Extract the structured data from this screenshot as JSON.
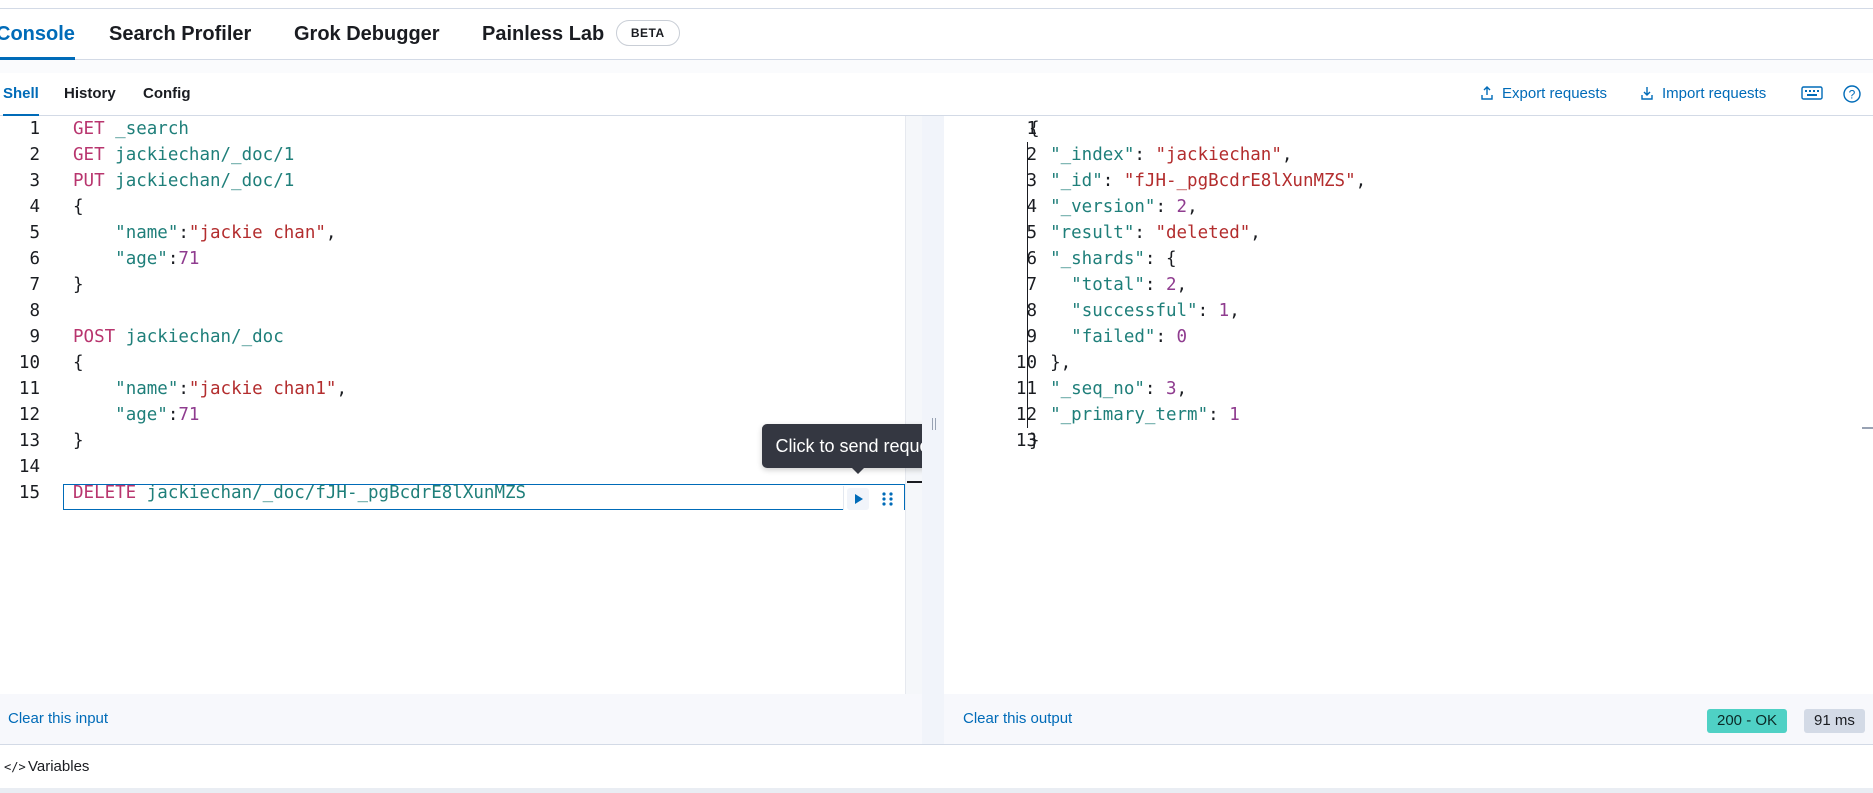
{
  "main_tabs": [
    {
      "label": "Console",
      "active": true
    },
    {
      "label": "Search Profiler",
      "active": false
    },
    {
      "label": "Grok Debugger",
      "active": false
    },
    {
      "label": "Painless Lab",
      "active": false,
      "badge": "BETA"
    }
  ],
  "sub_tabs": [
    {
      "label": "Shell",
      "active": true
    },
    {
      "label": "History",
      "active": false
    },
    {
      "label": "Config",
      "active": false
    }
  ],
  "actions": {
    "export": "Export requests",
    "import": "Import requests",
    "keyboard_icon": "keyboard-icon",
    "help_icon": "help-icon"
  },
  "request": {
    "line_numbers": [
      "1",
      "2",
      "3",
      "4",
      "5",
      "6",
      "7",
      "8",
      "9",
      "10",
      "11",
      "12",
      "13",
      "14",
      "15"
    ],
    "lines": [
      [
        {
          "t": "kw",
          "v": "GET"
        },
        {
          "t": "pun",
          "v": " "
        },
        {
          "t": "url",
          "v": "_search"
        }
      ],
      [
        {
          "t": "kw",
          "v": "GET"
        },
        {
          "t": "pun",
          "v": " "
        },
        {
          "t": "url",
          "v": "jackiechan/_doc/1"
        }
      ],
      [
        {
          "t": "kw",
          "v": "PUT"
        },
        {
          "t": "pun",
          "v": " "
        },
        {
          "t": "url",
          "v": "jackiechan/_doc/1"
        }
      ],
      [
        {
          "t": "pun",
          "v": "{"
        }
      ],
      [
        {
          "t": "pun",
          "v": "    "
        },
        {
          "t": "key",
          "v": "\"name\""
        },
        {
          "t": "pun",
          "v": ":"
        },
        {
          "t": "str",
          "v": "\"jackie chan\""
        },
        {
          "t": "pun",
          "v": ","
        }
      ],
      [
        {
          "t": "pun",
          "v": "    "
        },
        {
          "t": "key",
          "v": "\"age\""
        },
        {
          "t": "pun",
          "v": ":"
        },
        {
          "t": "num",
          "v": "71"
        }
      ],
      [
        {
          "t": "pun",
          "v": "}"
        }
      ],
      [],
      [
        {
          "t": "kw",
          "v": "POST"
        },
        {
          "t": "pun",
          "v": " "
        },
        {
          "t": "url",
          "v": "jackiechan/_doc"
        }
      ],
      [
        {
          "t": "pun",
          "v": "{"
        }
      ],
      [
        {
          "t": "pun",
          "v": "    "
        },
        {
          "t": "key",
          "v": "\"name\""
        },
        {
          "t": "pun",
          "v": ":"
        },
        {
          "t": "str",
          "v": "\"jackie chan1\""
        },
        {
          "t": "pun",
          "v": ","
        }
      ],
      [
        {
          "t": "pun",
          "v": "    "
        },
        {
          "t": "key",
          "v": "\"age\""
        },
        {
          "t": "pun",
          "v": ":"
        },
        {
          "t": "num",
          "v": "71"
        }
      ],
      [
        {
          "t": "pun",
          "v": "}"
        }
      ],
      [],
      [
        {
          "t": "kw",
          "v": "DELETE"
        },
        {
          "t": "pun",
          "v": " "
        },
        {
          "t": "url",
          "v": "jackiechan/_doc/fJH-_pgBcdrE8lXunMZS"
        }
      ]
    ]
  },
  "response": {
    "line_numbers": [
      "1",
      "2",
      "3",
      "4",
      "5",
      "6",
      "7",
      "8",
      "9",
      "10",
      "11",
      "12",
      "13"
    ],
    "lines": [
      [
        {
          "t": "pun",
          "v": "{"
        }
      ],
      [
        {
          "t": "pun",
          "v": "  "
        },
        {
          "t": "key",
          "v": "\"_index\""
        },
        {
          "t": "pun",
          "v": ": "
        },
        {
          "t": "str",
          "v": "\"jackiechan\""
        },
        {
          "t": "pun",
          "v": ","
        }
      ],
      [
        {
          "t": "pun",
          "v": "  "
        },
        {
          "t": "key",
          "v": "\"_id\""
        },
        {
          "t": "pun",
          "v": ": "
        },
        {
          "t": "str",
          "v": "\"fJH-_pgBcdrE8lXunMZS\""
        },
        {
          "t": "pun",
          "v": ","
        }
      ],
      [
        {
          "t": "pun",
          "v": "  "
        },
        {
          "t": "key",
          "v": "\"_version\""
        },
        {
          "t": "pun",
          "v": ": "
        },
        {
          "t": "num",
          "v": "2"
        },
        {
          "t": "pun",
          "v": ","
        }
      ],
      [
        {
          "t": "pun",
          "v": "  "
        },
        {
          "t": "key",
          "v": "\"result\""
        },
        {
          "t": "pun",
          "v": ": "
        },
        {
          "t": "str",
          "v": "\"deleted\""
        },
        {
          "t": "pun",
          "v": ","
        }
      ],
      [
        {
          "t": "pun",
          "v": "  "
        },
        {
          "t": "key",
          "v": "\"_shards\""
        },
        {
          "t": "pun",
          "v": ": {"
        }
      ],
      [
        {
          "t": "pun",
          "v": "    "
        },
        {
          "t": "key",
          "v": "\"total\""
        },
        {
          "t": "pun",
          "v": ": "
        },
        {
          "t": "num",
          "v": "2"
        },
        {
          "t": "pun",
          "v": ","
        }
      ],
      [
        {
          "t": "pun",
          "v": "    "
        },
        {
          "t": "key",
          "v": "\"successful\""
        },
        {
          "t": "pun",
          "v": ": "
        },
        {
          "t": "num",
          "v": "1"
        },
        {
          "t": "pun",
          "v": ","
        }
      ],
      [
        {
          "t": "pun",
          "v": "    "
        },
        {
          "t": "key",
          "v": "\"failed\""
        },
        {
          "t": "pun",
          "v": ": "
        },
        {
          "t": "num",
          "v": "0"
        }
      ],
      [
        {
          "t": "pun",
          "v": "  },"
        }
      ],
      [
        {
          "t": "pun",
          "v": "  "
        },
        {
          "t": "key",
          "v": "\"_seq_no\""
        },
        {
          "t": "pun",
          "v": ": "
        },
        {
          "t": "num",
          "v": "3"
        },
        {
          "t": "pun",
          "v": ","
        }
      ],
      [
        {
          "t": "pun",
          "v": "  "
        },
        {
          "t": "key",
          "v": "\"_primary_term\""
        },
        {
          "t": "pun",
          "v": ": "
        },
        {
          "t": "num",
          "v": "1"
        }
      ],
      [
        {
          "t": "pun",
          "v": "}"
        }
      ]
    ]
  },
  "tooltip": "Click to send request",
  "footer": {
    "clear_input": "Clear this input",
    "clear_output": "Clear this output",
    "status": "200 - OK",
    "duration": "91 ms"
  },
  "variables_label": "Variables",
  "colors": {
    "accent": "#006bb8",
    "status_ok": "#4fd1c5",
    "keyword": "#b8356e",
    "string": "#b32d2e",
    "key": "#1f7f7a",
    "number": "#8f3c8f"
  }
}
